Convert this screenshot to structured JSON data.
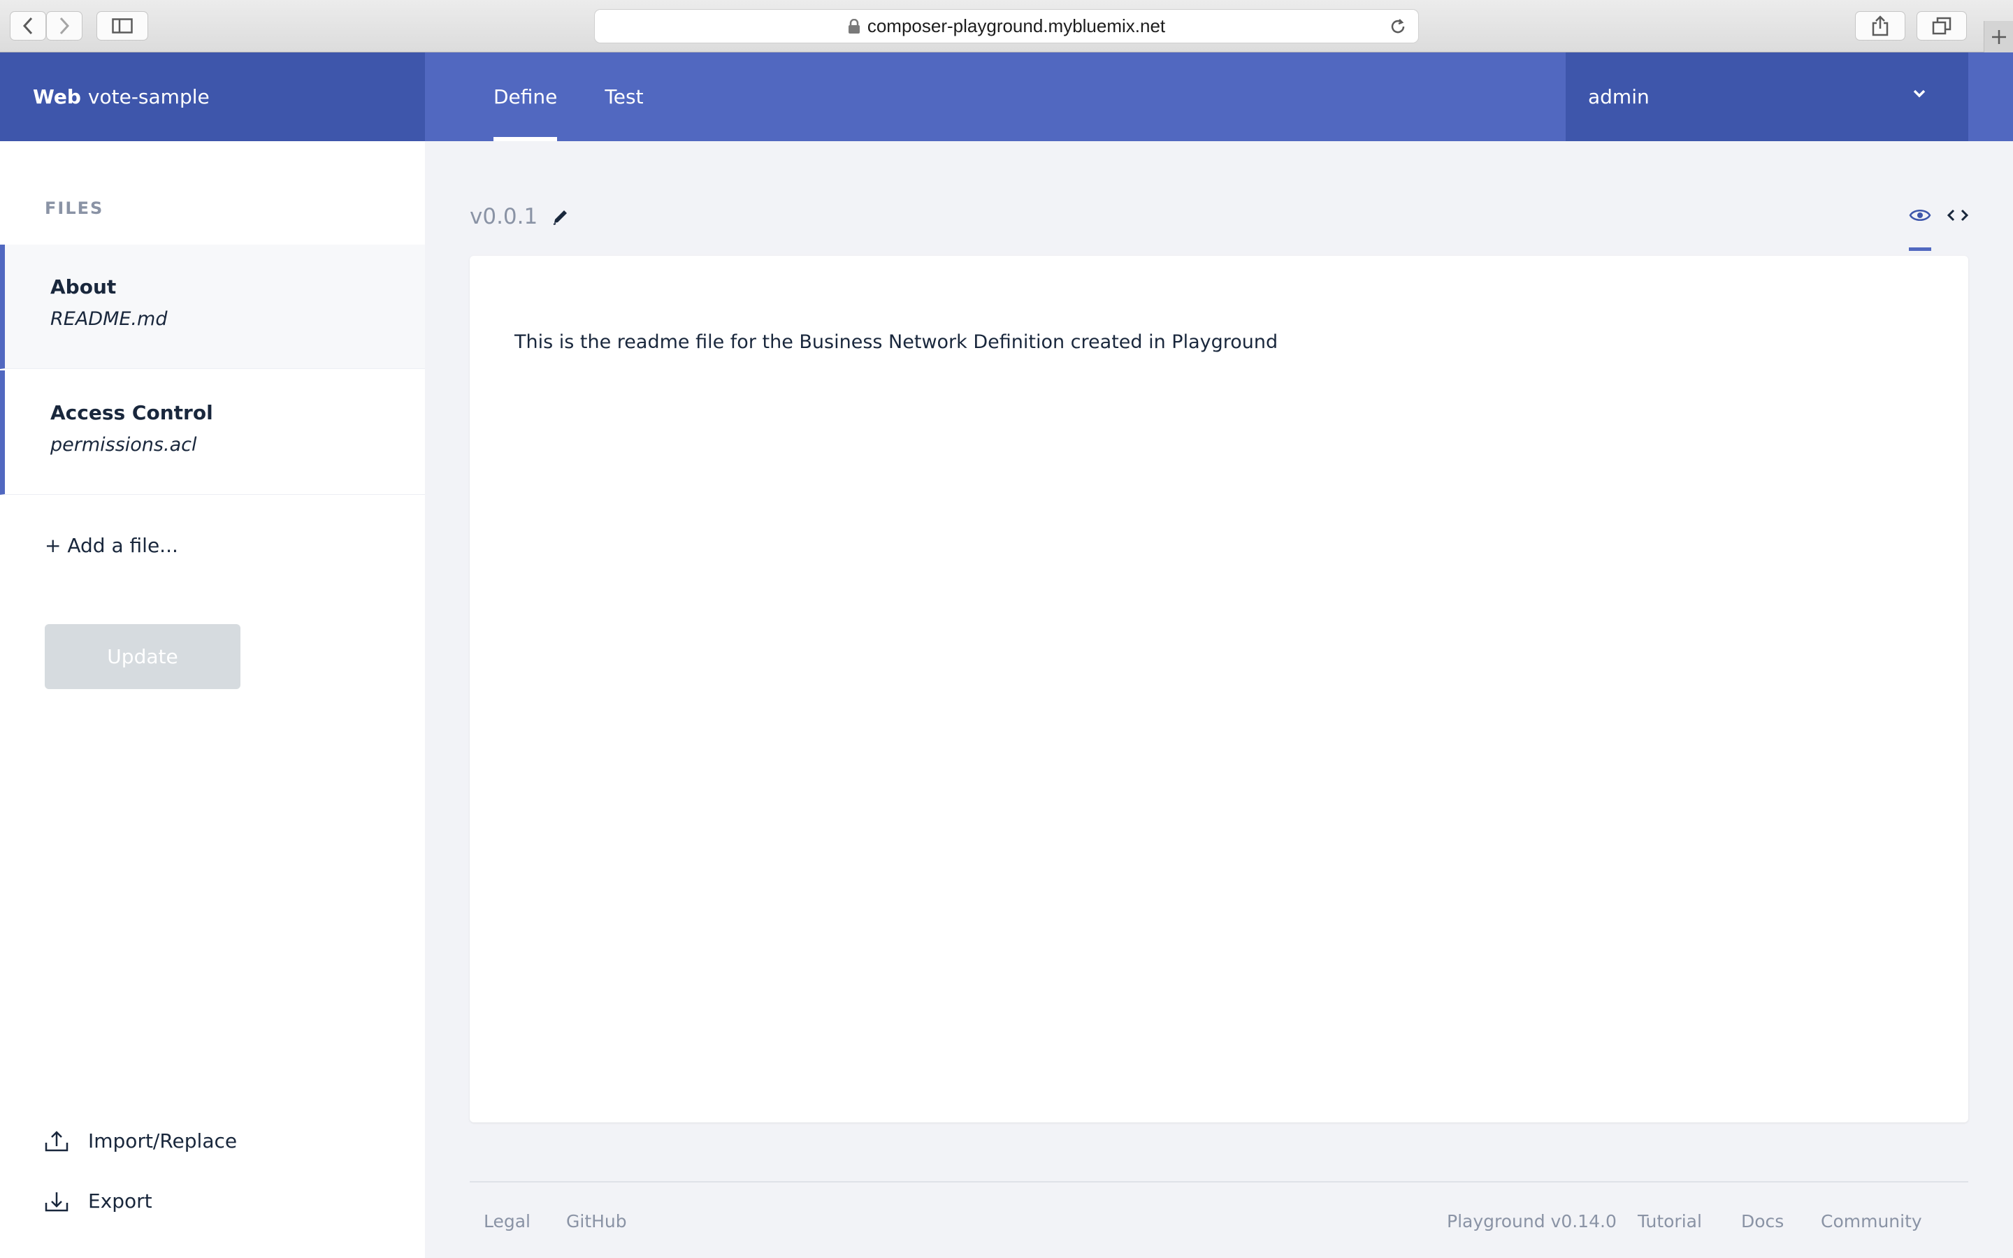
{
  "browser": {
    "url": "composer-playground.mybluemix.net"
  },
  "header": {
    "brand_bold": "Web",
    "brand_name": "vote-sample",
    "tabs": [
      {
        "label": "Define",
        "active": true
      },
      {
        "label": "Test",
        "active": false
      }
    ],
    "user": "admin"
  },
  "sidebar": {
    "title": "FILES",
    "files": [
      {
        "name": "About",
        "path": "README.md"
      },
      {
        "name": "Access Control",
        "path": "permissions.acl"
      }
    ],
    "add_file": "+ Add a file...",
    "update_label": "Update",
    "import_label": "Import/Replace",
    "export_label": "Export"
  },
  "main": {
    "version": "v0.0.1",
    "readme_text": "This is the readme file for the Business Network Definition created in Playground"
  },
  "footer": {
    "legal": "Legal",
    "github": "GitHub",
    "playground_version": "Playground v0.14.0",
    "tutorial": "Tutorial",
    "docs": "Docs",
    "community": "Community"
  },
  "colors": {
    "header": "#5168c0",
    "header_dark": "#3e56ab",
    "accent": "#5168c0"
  }
}
